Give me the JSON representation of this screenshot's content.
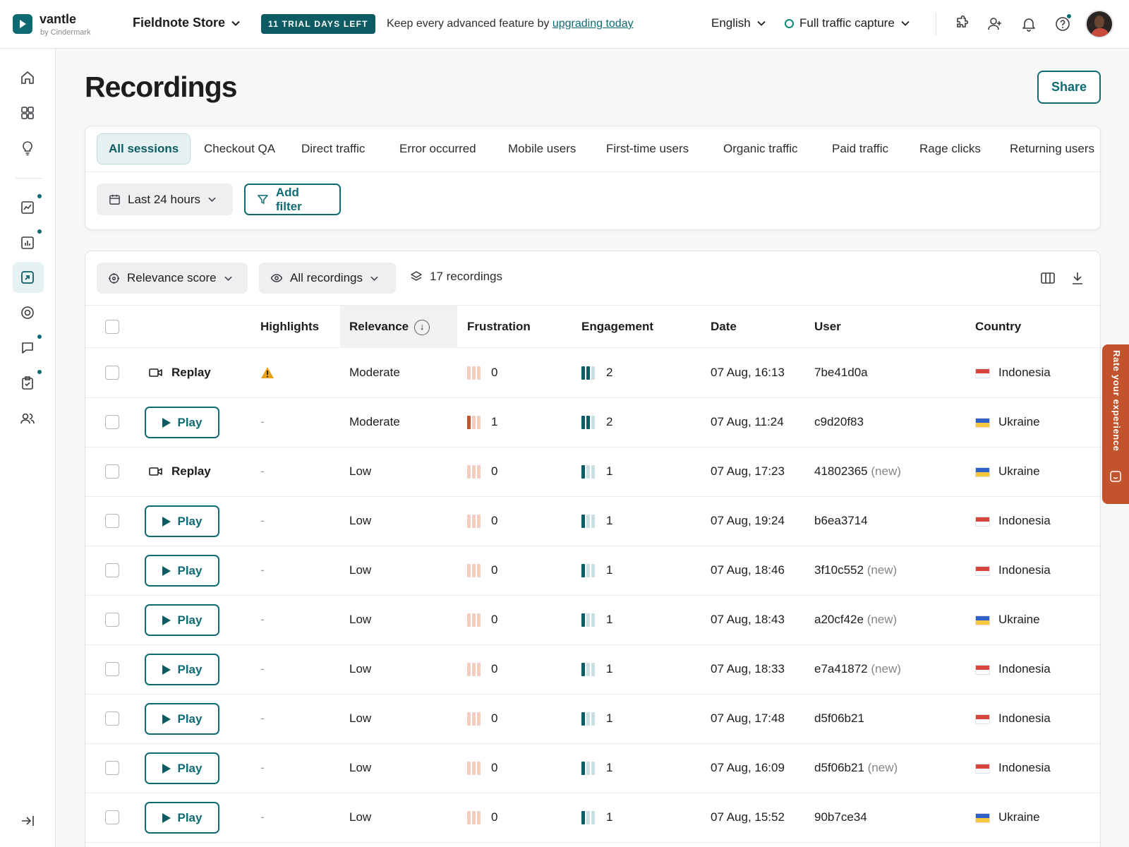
{
  "app": {
    "name": "vantle",
    "subtitle": "by Cindermark"
  },
  "header": {
    "store": "Fieldnote Store",
    "trial_badge": "11 TRIAL DAYS LEFT",
    "promo_text": "Keep every advanced feature by ",
    "promo_link": "upgrading today",
    "language": "English",
    "capture": "Full traffic capture",
    "icons": [
      "puzzle-icon",
      "add-user-icon",
      "bell-icon",
      "help-icon"
    ]
  },
  "sidebar": {
    "items": [
      "home-icon",
      "dashboard-icon",
      "insights-icon",
      "trends-icon",
      "reports-icon",
      "recordings-icon",
      "heatmaps-icon",
      "feedback-icon",
      "surveys-icon",
      "users-icon"
    ],
    "active": "recordings-icon",
    "collapse": "collapse-icon"
  },
  "page": {
    "title": "Recordings",
    "share_label": "Share"
  },
  "segments": {
    "tabs": [
      "All sessions",
      "Checkout QA",
      "Direct traffic",
      "Error occurred",
      "Mobile users",
      "First-time users",
      "Organic traffic",
      "Paid traffic",
      "Rage clicks",
      "Returning users"
    ],
    "active": 0
  },
  "filters": {
    "date_range": "Last 24 hours",
    "add_filter": "Add filter"
  },
  "toolbar": {
    "sort": "Relevance score",
    "view": "All recordings",
    "count": "17 recordings"
  },
  "table": {
    "columns": {
      "highlights": "Highlights",
      "relevance": "Relevance",
      "frustration": "Frustration",
      "engagement": "Engagement",
      "date": "Date",
      "user": "User",
      "country": "Country"
    },
    "rows": [
      {
        "action": "Replay",
        "highlight": "warning",
        "relevance": "Moderate",
        "frustration": 0,
        "engagement": 2,
        "date": "07 Aug, 16:13",
        "user": "7be41d0a",
        "new": false,
        "country": "Indonesia",
        "flag": "id"
      },
      {
        "action": "Play",
        "highlight": "-",
        "relevance": "Moderate",
        "frustration": 1,
        "engagement": 2,
        "date": "07 Aug, 11:24",
        "user": "c9d20f83",
        "new": false,
        "country": "Ukraine",
        "flag": "ua"
      },
      {
        "action": "Replay",
        "highlight": "-",
        "relevance": "Low",
        "frustration": 0,
        "engagement": 1,
        "date": "07 Aug, 17:23",
        "user": "41802365",
        "new": true,
        "country": "Ukraine",
        "flag": "ua"
      },
      {
        "action": "Play",
        "highlight": "-",
        "relevance": "Low",
        "frustration": 0,
        "engagement": 1,
        "date": "07 Aug, 19:24",
        "user": "b6ea3714",
        "new": false,
        "country": "Indonesia",
        "flag": "id"
      },
      {
        "action": "Play",
        "highlight": "-",
        "relevance": "Low",
        "frustration": 0,
        "engagement": 1,
        "date": "07 Aug, 18:46",
        "user": "3f10c552",
        "new": true,
        "country": "Indonesia",
        "flag": "id"
      },
      {
        "action": "Play",
        "highlight": "-",
        "relevance": "Low",
        "frustration": 0,
        "engagement": 1,
        "date": "07 Aug, 18:43",
        "user": "a20cf42e",
        "new": true,
        "country": "Ukraine",
        "flag": "ua"
      },
      {
        "action": "Play",
        "highlight": "-",
        "relevance": "Low",
        "frustration": 0,
        "engagement": 1,
        "date": "07 Aug, 18:33",
        "user": "e7a41872",
        "new": true,
        "country": "Indonesia",
        "flag": "id"
      },
      {
        "action": "Play",
        "highlight": "-",
        "relevance": "Low",
        "frustration": 0,
        "engagement": 1,
        "date": "07 Aug, 17:48",
        "user": "d5f06b21",
        "new": false,
        "country": "Indonesia",
        "flag": "id"
      },
      {
        "action": "Play",
        "highlight": "-",
        "relevance": "Low",
        "frustration": 0,
        "engagement": 1,
        "date": "07 Aug, 16:09",
        "user": "d5f06b21",
        "new": true,
        "country": "Indonesia",
        "flag": "id"
      },
      {
        "action": "Play",
        "highlight": "-",
        "relevance": "Low",
        "frustration": 0,
        "engagement": 1,
        "date": "07 Aug, 15:52",
        "user": "90b7ce34",
        "new": false,
        "country": "Ukraine",
        "flag": "ua"
      }
    ],
    "new_label": "(new)"
  },
  "feedback_tab": "Rate your experience",
  "colors": {
    "accent": "#0e6b73",
    "frustration": "#c3532c",
    "frustration_dim": "#f2cdc0",
    "engagement": "#0e5c63",
    "engagement_dim": "#c9dfe1",
    "warning": "#e5a21a"
  }
}
